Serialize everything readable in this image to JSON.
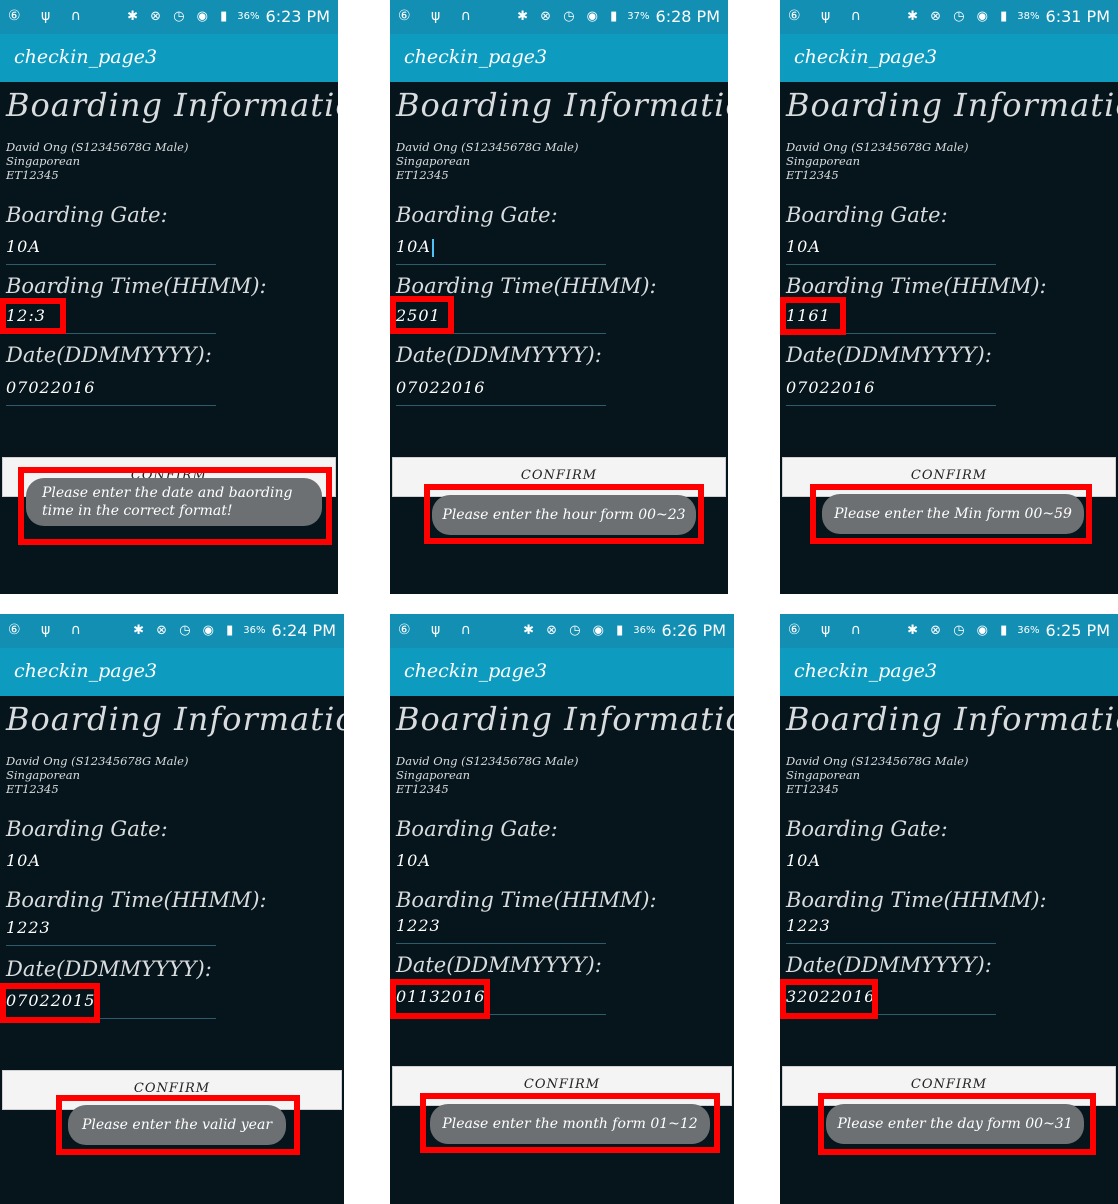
{
  "screens": [
    {
      "status_time": "6:23 PM",
      "battery": "36%",
      "app_title": "checkin_page3",
      "heading": "Boarding Information:",
      "info_lines": [
        "David Ong (S12345678G Male)",
        "Singaporean",
        "ET12345"
      ],
      "gate_label": "Boarding Gate:",
      "gate_value": "10A",
      "time_label": "Boarding Time(HHMM):",
      "time_value": "12:3",
      "date_label": "Date(DDMMYYYY):",
      "date_value": "07022016",
      "confirm_label": "CONFIRM",
      "toast": "Please enter the date and baording time in the correct format!"
    },
    {
      "status_time": "6:28 PM",
      "battery": "37%",
      "app_title": "checkin_page3",
      "heading": "Boarding Information:",
      "info_lines": [
        "David Ong (S12345678G Male)",
        "Singaporean",
        "ET12345"
      ],
      "gate_label": "Boarding Gate:",
      "gate_value": "10A",
      "time_label": "Boarding Time(HHMM):",
      "time_value": "2501",
      "date_label": "Date(DDMMYYYY):",
      "date_value": "07022016",
      "confirm_label": "CONFIRM",
      "toast": "Please enter the hour form 00~23"
    },
    {
      "status_time": "6:31 PM",
      "battery": "38%",
      "app_title": "checkin_page3",
      "heading": "Boarding Information:",
      "info_lines": [
        "David Ong (S12345678G Male)",
        "Singaporean",
        "ET12345"
      ],
      "gate_label": "Boarding Gate:",
      "gate_value": "10A",
      "time_label": "Boarding Time(HHMM):",
      "time_value": "1161",
      "date_label": "Date(DDMMYYYY):",
      "date_value": "07022016",
      "confirm_label": "CONFIRM",
      "toast": "Please enter the Min form 00~59"
    },
    {
      "status_time": "6:24 PM",
      "battery": "36%",
      "app_title": "checkin_page3",
      "heading": "Boarding Information:",
      "info_lines": [
        "David Ong (S12345678G Male)",
        "Singaporean",
        "ET12345"
      ],
      "gate_label": "Boarding Gate:",
      "gate_value": "10A",
      "time_label": "Boarding Time(HHMM):",
      "time_value": "1223",
      "date_label": "Date(DDMMYYYY):",
      "date_value": "07022015",
      "confirm_label": "CONFIRM",
      "toast": "Please enter the valid year"
    },
    {
      "status_time": "6:26 PM",
      "battery": "36%",
      "app_title": "checkin_page3",
      "heading": "Boarding Information:",
      "info_lines": [
        "David Ong (S12345678G Male)",
        "Singaporean",
        "ET12345"
      ],
      "gate_label": "Boarding Gate:",
      "gate_value": "10A",
      "time_label": "Boarding Time(HHMM):",
      "time_value": "1223",
      "date_label": "Date(DDMMYYYY):",
      "date_value": "01132016",
      "confirm_label": "CONFIRM",
      "toast": "Please enter the month form 01~12"
    },
    {
      "status_time": "6:25 PM",
      "battery": "36%",
      "app_title": "checkin_page3",
      "heading": "Boarding Information:",
      "info_lines": [
        "David Ong (S12345678G Male)",
        "Singaporean",
        "ET12345"
      ],
      "gate_label": "Boarding Gate:",
      "gate_value": "10A",
      "time_label": "Boarding Time(HHMM):",
      "time_value": "1223",
      "date_label": "Date(DDMMYYYY):",
      "date_value": "32022016",
      "confirm_label": "CONFIRM",
      "toast": "Please enter the day form 00~31"
    }
  ],
  "colors": {
    "status_bar": "#138fb3",
    "app_bar": "#0d9cc0",
    "screen_bg": "#06151c",
    "highlight": "#ff0000",
    "toast_bg": "#6c7073"
  }
}
